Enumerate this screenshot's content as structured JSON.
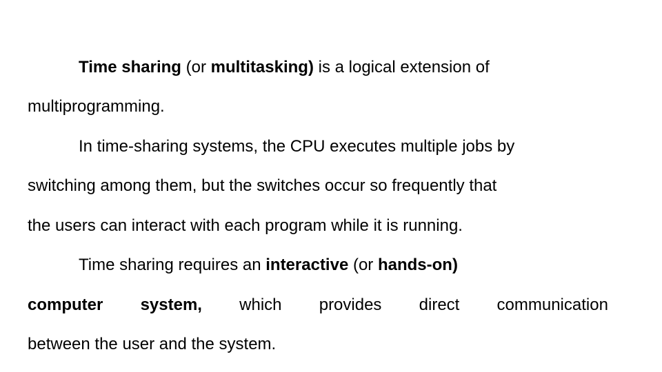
{
  "slide": {
    "paragraphs": [
      {
        "lines": [
          {
            "segments": [
              {
                "text": "Time sharing",
                "bold": true
              },
              {
                "text": " (or ",
                "bold": false
              },
              {
                "text": "multitasking)",
                "bold": true
              },
              {
                "text": " is a logical extension of",
                "bold": false
              }
            ]
          },
          {
            "segments": [
              {
                "text": "multiprogramming.",
                "bold": false
              }
            ]
          }
        ]
      },
      {
        "lines": [
          {
            "segments": [
              {
                "text": "In time-sharing systems, the CPU executes multiple jobs by",
                "bold": false
              }
            ]
          },
          {
            "segments": [
              {
                "text": "switching among them, but the switches occur so frequently that",
                "bold": false
              }
            ]
          },
          {
            "segments": [
              {
                "text": "the users can interact with each program while it is running.",
                "bold": false
              }
            ]
          }
        ]
      },
      {
        "lines": [
          {
            "segments": [
              {
                "text": "Time sharing requires an ",
                "bold": false
              },
              {
                "text": "interactive",
                "bold": true
              },
              {
                "text": " (or ",
                "bold": false
              },
              {
                "text": "hands-on)",
                "bold": true
              }
            ]
          },
          {
            "words": [
              {
                "text": "computer",
                "bold": true
              },
              {
                "text": "system,",
                "bold": true
              },
              {
                "text": "which",
                "bold": false
              },
              {
                "text": "provides",
                "bold": false
              },
              {
                "text": "direct",
                "bold": false
              },
              {
                "text": "communication",
                "bold": false
              }
            ]
          },
          {
            "segments": [
              {
                "text": "between the user and the system.",
                "bold": false
              }
            ]
          }
        ]
      }
    ]
  }
}
